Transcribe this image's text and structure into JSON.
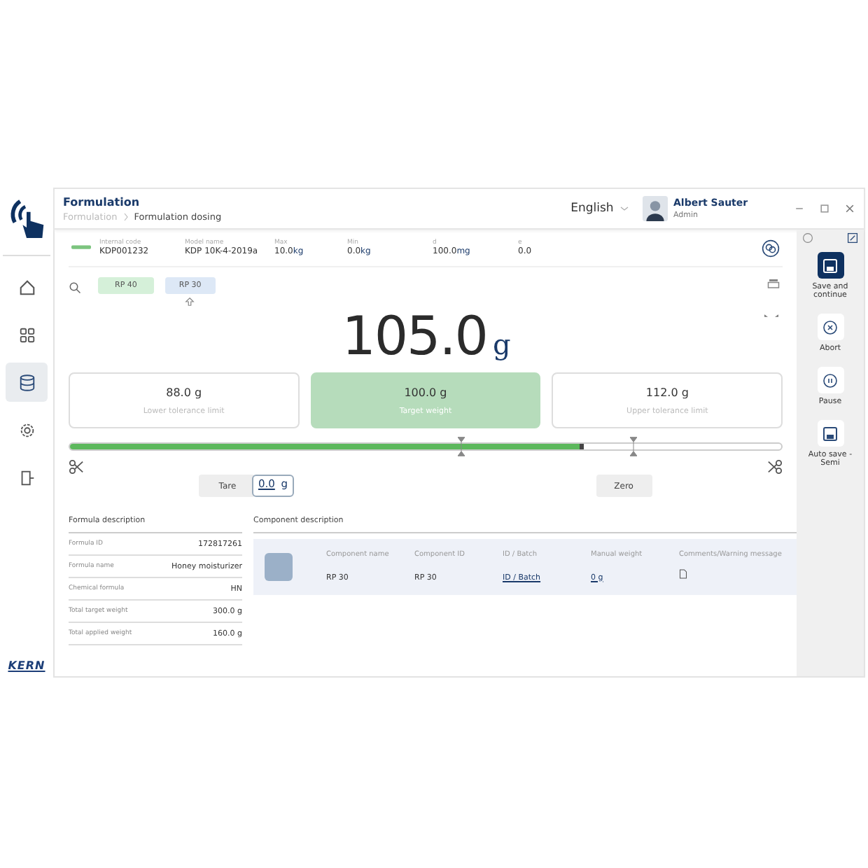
{
  "nav": [
    {
      "kind": "home",
      "selected": false
    },
    {
      "kind": "grid",
      "selected": false
    },
    {
      "kind": "database",
      "selected": true
    },
    {
      "kind": "gear",
      "selected": false
    },
    {
      "kind": "exit",
      "selected": false
    }
  ],
  "brand": "KERN",
  "header": {
    "title": "Formulation",
    "breadcrumb": [
      "Formulation",
      "Formulation dosing"
    ],
    "language": "English",
    "user": {
      "name": "Albert Sauter",
      "role": "Admin"
    }
  },
  "scale_info": [
    {
      "label": "Internal code",
      "value": "KDP001232"
    },
    {
      "label": "Model name",
      "value": "KDP 10K-4-2019a"
    },
    {
      "label": "Max",
      "value": "10.0",
      "unit": "kg"
    },
    {
      "label": "Min",
      "value": "0.0",
      "unit": "kg"
    },
    {
      "label": "d",
      "value": "100.0",
      "unit": "mg"
    },
    {
      "label": "e",
      "value": "0.0"
    }
  ],
  "component_tags": [
    {
      "label": "RP 40",
      "color": "#d5f0d9",
      "selected": false
    },
    {
      "label": "RP 30",
      "color": "#dde8f6",
      "selected": true
    }
  ],
  "weight": {
    "reading": "105.0",
    "unit": "g"
  },
  "limits": [
    {
      "value": "88.0 g",
      "label": "Lower tolerance limit",
      "highlighted": false
    },
    {
      "value": "100.0 g",
      "label": "Target weight",
      "highlighted": true
    },
    {
      "value": "112.0 g",
      "label": "Upper tolerance limit",
      "highlighted": false
    }
  ],
  "progress": {
    "level": 0.717
  },
  "tare": {
    "label": "Tare",
    "value": "0.0",
    "unit": "g"
  },
  "zero": {
    "label": "Zero"
  },
  "formula": {
    "title": "Formula description",
    "rows": [
      {
        "label": "Formula ID",
        "value": "172817261"
      },
      {
        "label": "Formula name",
        "value": "Honey moisturizer"
      },
      {
        "label": "Chemical formula",
        "value": "HN"
      },
      {
        "label": "Total target weight",
        "value": "300.0 g"
      },
      {
        "label": "Total applied weight",
        "value": "160.0 g"
      }
    ]
  },
  "component": {
    "title": "Component description",
    "columns": [
      {
        "label": "Component name",
        "value": "RP 30",
        "kind": "text"
      },
      {
        "label": "Component ID",
        "value": "RP 30",
        "kind": "text"
      },
      {
        "label": "ID / Batch",
        "value": "ID / Batch",
        "kind": "link"
      },
      {
        "label": "Manual weight",
        "value": "0 g",
        "kind": "link"
      },
      {
        "label": "Comments/Warning message",
        "kind": "icon"
      }
    ]
  },
  "actions": [
    {
      "label": "Save and continue",
      "kind": "save",
      "primary": true
    },
    {
      "label": "Abort",
      "kind": "abort",
      "primary": false
    },
    {
      "label": "Pause",
      "kind": "pause",
      "primary": false
    },
    {
      "label": "Auto save - Semi",
      "kind": "autosave",
      "primary": false
    }
  ]
}
